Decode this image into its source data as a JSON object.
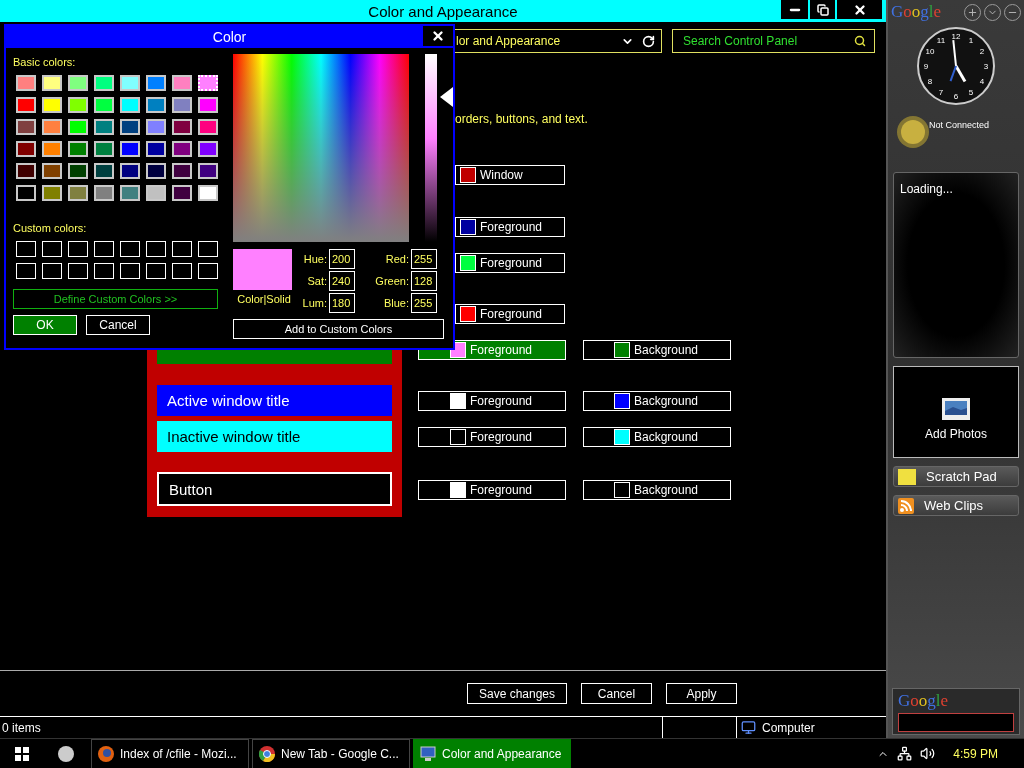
{
  "window": {
    "title": "Color and Appearance"
  },
  "address": {
    "value": "lor and Appearance"
  },
  "search": {
    "placeholder": "Search Control Panel"
  },
  "description": "orders, buttons, and text.",
  "upper_rows": [
    {
      "label": "Window",
      "color": "#c00000",
      "selected": false
    },
    {
      "label": "Foreground",
      "color": "#0000a0",
      "selected": false
    },
    {
      "label": "Foreground",
      "color": "#00ff40",
      "selected": false
    },
    {
      "label": "Foreground",
      "color": "#ff0000",
      "selected": false
    }
  ],
  "preview": {
    "color": "#c00000",
    "items": [
      {
        "kind": "bar",
        "color": "#008000"
      },
      {
        "kind": "title",
        "text": "Active window title",
        "color": "#0000ff"
      },
      {
        "kind": "title",
        "text": "Inactive window title",
        "color": "#00ffff"
      },
      {
        "kind": "button",
        "text": "Button",
        "color": "#000000"
      }
    ]
  },
  "lower_rows": [
    {
      "foreground": {
        "label": "Foreground",
        "color": "#ff80ff",
        "selected": true
      },
      "background": {
        "label": "Background",
        "color": "#008000",
        "selected": false
      }
    },
    {
      "foreground": {
        "label": "Foreground",
        "color": "#ffffff",
        "selected": false
      },
      "background": {
        "label": "Background",
        "color": "#0000ff",
        "selected": false
      }
    },
    {
      "foreground": {
        "label": "Foreground",
        "color": "#000000",
        "selected": false
      },
      "background": {
        "label": "Background",
        "color": "#00ffff",
        "selected": false
      }
    },
    {
      "foreground": {
        "label": "Foreground",
        "color": "#ffffff",
        "selected": false
      },
      "background": {
        "label": "Background",
        "color": "#000000",
        "selected": false
      }
    }
  ],
  "color_dialog": {
    "title": "Color",
    "basic_label": "Basic colors:",
    "basic_colors": [
      {
        "color": "#ff8080",
        "selected": false
      },
      {
        "color": "#ffff80",
        "selected": false
      },
      {
        "color": "#80ff80",
        "selected": false
      },
      {
        "color": "#00ff80",
        "selected": false
      },
      {
        "color": "#80ffff",
        "selected": false
      },
      {
        "color": "#0080ff",
        "selected": false
      },
      {
        "color": "#ff80c0",
        "selected": false
      },
      {
        "color": "#ff80ff",
        "selected": true
      },
      {
        "color": "#ff0000",
        "selected": false
      },
      {
        "color": "#ffff00",
        "selected": false
      },
      {
        "color": "#80ff00",
        "selected": false
      },
      {
        "color": "#00ff40",
        "selected": false
      },
      {
        "color": "#00ffff",
        "selected": false
      },
      {
        "color": "#0080c0",
        "selected": false
      },
      {
        "color": "#8080c0",
        "selected": false
      },
      {
        "color": "#ff00ff",
        "selected": false
      },
      {
        "color": "#804040",
        "selected": false
      },
      {
        "color": "#ff8040",
        "selected": false
      },
      {
        "color": "#00ff00",
        "selected": false
      },
      {
        "color": "#008080",
        "selected": false
      },
      {
        "color": "#004080",
        "selected": false
      },
      {
        "color": "#8080ff",
        "selected": false
      },
      {
        "color": "#800040",
        "selected": false
      },
      {
        "color": "#ff0080",
        "selected": false
      },
      {
        "color": "#800000",
        "selected": false
      },
      {
        "color": "#ff8000",
        "selected": false
      },
      {
        "color": "#008000",
        "selected": false
      },
      {
        "color": "#008040",
        "selected": false
      },
      {
        "color": "#0000ff",
        "selected": false
      },
      {
        "color": "#0000a0",
        "selected": false
      },
      {
        "color": "#800080",
        "selected": false
      },
      {
        "color": "#8000ff",
        "selected": false
      },
      {
        "color": "#400000",
        "selected": false
      },
      {
        "color": "#804000",
        "selected": false
      },
      {
        "color": "#004000",
        "selected": false
      },
      {
        "color": "#004040",
        "selected": false
      },
      {
        "color": "#000080",
        "selected": false
      },
      {
        "color": "#000040",
        "selected": false
      },
      {
        "color": "#400040",
        "selected": false
      },
      {
        "color": "#400080",
        "selected": false
      },
      {
        "color": "#000000",
        "selected": false
      },
      {
        "color": "#808000",
        "selected": false
      },
      {
        "color": "#808040",
        "selected": false
      },
      {
        "color": "#808080",
        "selected": false
      },
      {
        "color": "#408080",
        "selected": false
      },
      {
        "color": "#c0c0c0",
        "selected": false
      },
      {
        "color": "#400040",
        "selected": false
      },
      {
        "color": "#ffffff",
        "selected": false
      }
    ],
    "custom_label": "Custom colors:",
    "custom_colors": [
      {
        "color": "#000000"
      },
      {
        "color": "#000000"
      },
      {
        "color": "#000000"
      },
      {
        "color": "#000000"
      },
      {
        "color": "#000000"
      },
      {
        "color": "#000000"
      },
      {
        "color": "#000000"
      },
      {
        "color": "#000000"
      },
      {
        "color": "#000000"
      },
      {
        "color": "#000000"
      },
      {
        "color": "#000000"
      },
      {
        "color": "#000000"
      },
      {
        "color": "#000000"
      },
      {
        "color": "#000000"
      },
      {
        "color": "#000000"
      },
      {
        "color": "#000000"
      }
    ],
    "define_button": "Define Custom Colors >>",
    "ok": "OK",
    "cancel": "Cancel",
    "luminance": {
      "level": 0.77
    },
    "preview": {
      "color": "#ff80ff",
      "label": "Color|Solid"
    },
    "fields_left": [
      {
        "label": "Hue:",
        "value": "200"
      },
      {
        "label": "Sat:",
        "value": "240"
      },
      {
        "label": "Lum:",
        "value": "180"
      }
    ],
    "fields_right": [
      {
        "label": "Red:",
        "value": "255"
      },
      {
        "label": "Green:",
        "value": "128"
      },
      {
        "label": "Blue:",
        "value": "255"
      }
    ],
    "add_button": "Add to Custom Colors"
  },
  "footer_buttons": [
    "Save changes",
    "Cancel",
    "Apply"
  ],
  "status_bar": {
    "items": "0 items",
    "location": "Computer"
  },
  "sidebar": {
    "logo": "Google",
    "clock_numbers": [
      "12",
      "1",
      "2",
      "3",
      "4",
      "5",
      "6",
      "7",
      "8",
      "9",
      "10",
      "11"
    ],
    "weather": "Not Connected",
    "loading": "Loading...",
    "photos": "Add Photos",
    "buttons": [
      {
        "label": "Scratch Pad",
        "kind": "note"
      },
      {
        "label": "Web Clips",
        "kind": "rss"
      }
    ],
    "search_logo": "Google"
  },
  "taskbar": {
    "tasks": [
      {
        "label": "Index of /cfile - Mozi...",
        "kind": "firefox",
        "selected": false
      },
      {
        "label": "New Tab - Google C...",
        "kind": "chrome",
        "selected": false
      },
      {
        "label": "Color and Appearance",
        "kind": "control",
        "selected": true
      }
    ],
    "time": "4:59 PM"
  }
}
